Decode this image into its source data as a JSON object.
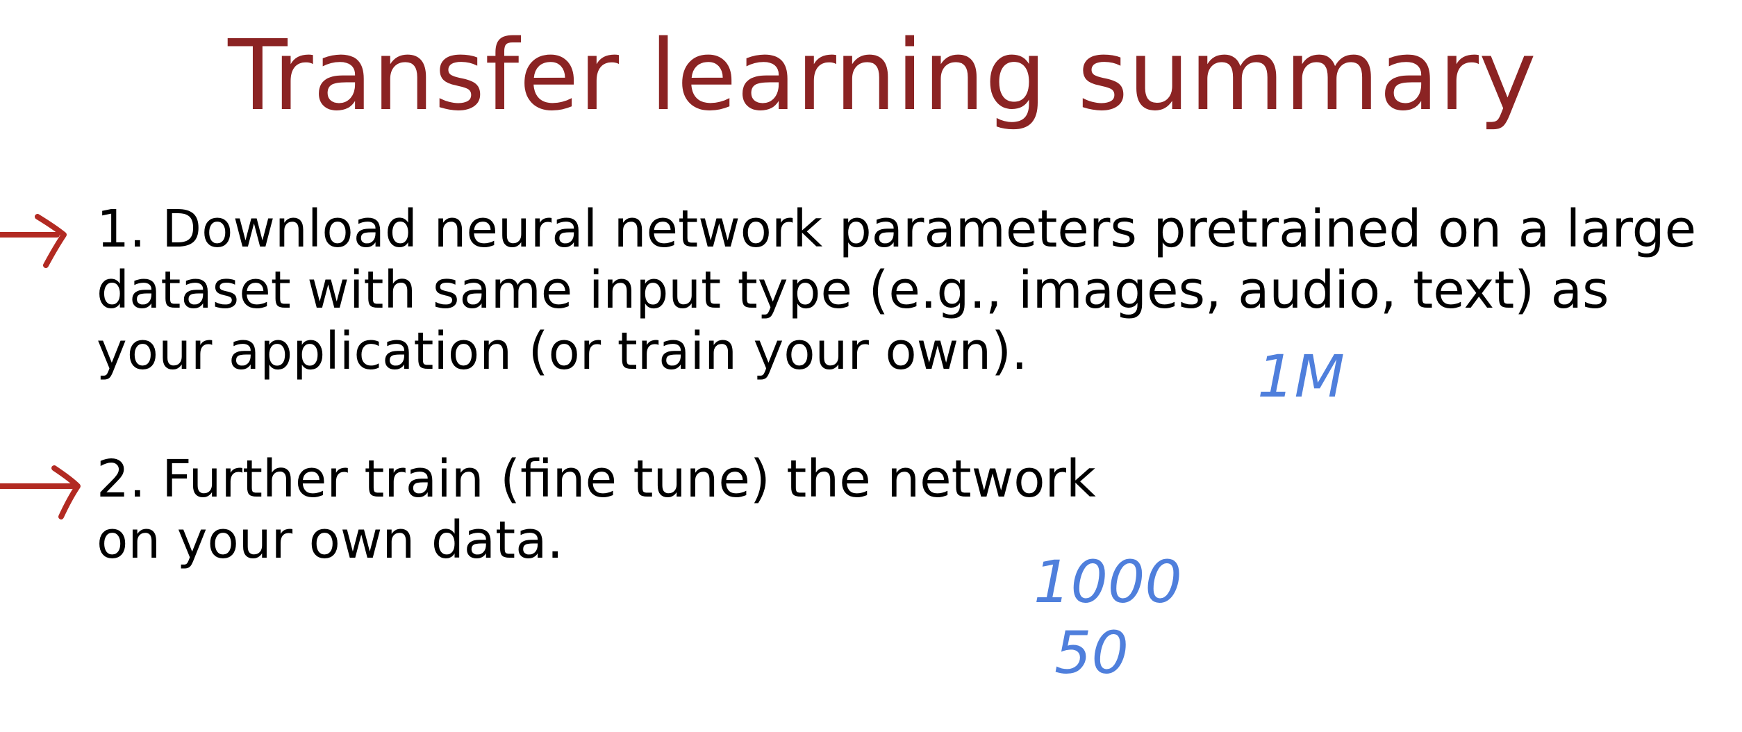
{
  "slide": {
    "title": "Transfer learning summary",
    "title_color": "#8b2323",
    "arrow_color": "#b22a22",
    "annotation_color": "#4f7fdc",
    "items": [
      {
        "lines": [
          "1. Download neural network parameters pretrained on a large",
          "dataset with same input type (e.g., images, audio, text) as",
          "your application (or train your own)."
        ]
      },
      {
        "lines": [
          "2. Further train (fine tune) the network",
          "on your own data."
        ]
      }
    ],
    "annotations": [
      "1M",
      "1000",
      "50"
    ]
  }
}
